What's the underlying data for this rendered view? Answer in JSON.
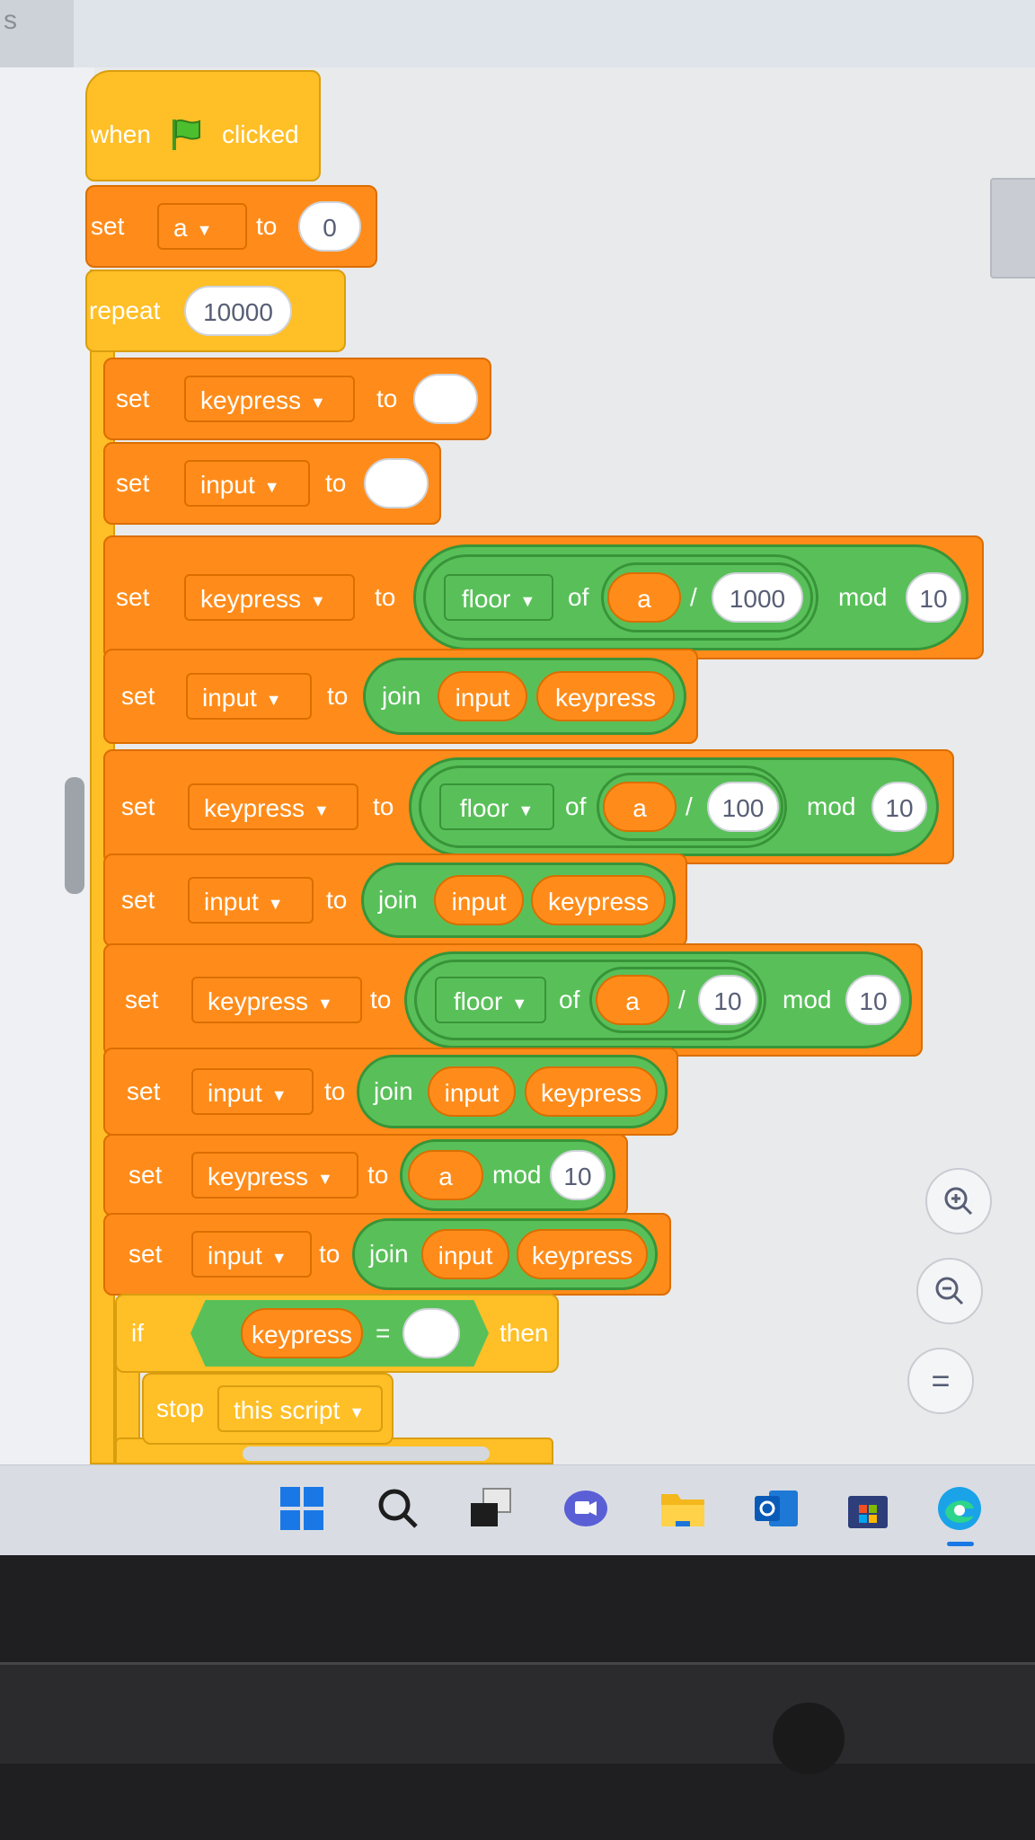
{
  "topbar": {
    "left_fragment": "s"
  },
  "blocks": {
    "hat": {
      "when": "when",
      "clicked": "clicked"
    },
    "set_a": {
      "set": "set",
      "var": "a",
      "to": "to",
      "value": "0"
    },
    "repeat": {
      "label": "repeat",
      "count": "10000"
    },
    "set_kp_blank": {
      "set": "set",
      "var": "keypress",
      "to": "to",
      "value": ""
    },
    "set_in_blank": {
      "set": "set",
      "var": "input",
      "to": "to",
      "value": ""
    },
    "kp1": {
      "set": "set",
      "var": "keypress",
      "to": "to",
      "fn": "floor",
      "of": "of",
      "a": "a",
      "div": "/",
      "divisor": "1000",
      "mod": "mod",
      "modval": "10"
    },
    "in1": {
      "set": "set",
      "var": "input",
      "to": "to",
      "join": "join",
      "arg1": "input",
      "arg2": "keypress"
    },
    "kp2": {
      "set": "set",
      "var": "keypress",
      "to": "to",
      "fn": "floor",
      "of": "of",
      "a": "a",
      "div": "/",
      "divisor": "100",
      "mod": "mod",
      "modval": "10"
    },
    "in2": {
      "set": "set",
      "var": "input",
      "to": "to",
      "join": "join",
      "arg1": "input",
      "arg2": "keypress"
    },
    "kp3": {
      "set": "set",
      "var": "keypress",
      "to": "to",
      "fn": "floor",
      "of": "of",
      "a": "a",
      "div": "/",
      "divisor": "10",
      "mod": "mod",
      "modval": "10"
    },
    "in3": {
      "set": "set",
      "var": "input",
      "to": "to",
      "join": "join",
      "arg1": "input",
      "arg2": "keypress"
    },
    "kp4": {
      "set": "set",
      "var": "keypress",
      "to": "to",
      "a": "a",
      "mod": "mod",
      "modval": "10"
    },
    "in4": {
      "set": "set",
      "var": "input",
      "to": "to",
      "join": "join",
      "arg1": "input",
      "arg2": "keypress"
    },
    "if": {
      "if": "if",
      "left": "keypress",
      "eq": "=",
      "right": "",
      "then": "then"
    },
    "stop": {
      "stop": "stop",
      "option": "this script"
    }
  },
  "zoom": {
    "in": "zoom-in",
    "out": "zoom-out",
    "reset": "="
  },
  "taskbar": [
    "windows-start",
    "search",
    "task-view",
    "teams-chat",
    "file-explorer",
    "outlook",
    "microsoft-store",
    "edge"
  ],
  "colors": {
    "events": "#ffbf26",
    "variables": "#ff8c1a",
    "operators": "#59c059",
    "control": "#ffbf26"
  }
}
